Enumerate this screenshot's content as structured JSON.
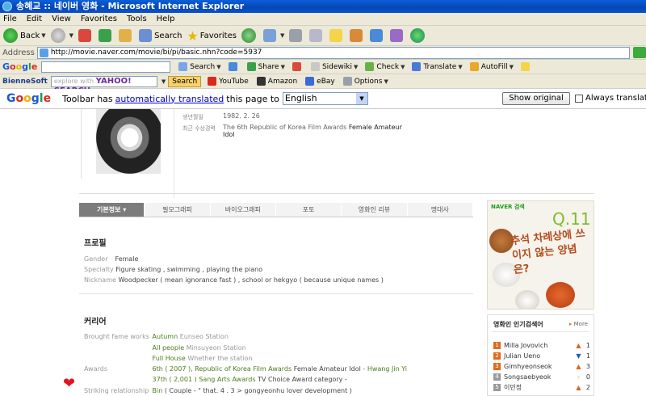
{
  "window": {
    "title": "송혜교 :: 네이버 영화 - Microsoft Internet Explorer"
  },
  "menu": [
    "File",
    "Edit",
    "View",
    "Favorites",
    "Tools",
    "Help"
  ],
  "toolbar": {
    "back": "Back",
    "search": "Search",
    "favorites": "Favorites"
  },
  "address": {
    "label": "Address",
    "url": "http://movie.naver.com/movie/bi/pi/basic.nhn?code=5937"
  },
  "google_toolbar": {
    "logo": "Google",
    "items": [
      "Search",
      "Share",
      "Sidewiki",
      "Check",
      "Translate",
      "AutoFill"
    ]
  },
  "bienne_toolbar": {
    "brand": "BienneSoft",
    "search_placeholder": "explore with",
    "search_brand": "YAHOO! SEARCH",
    "search_button": "Search",
    "items": [
      "YouTube",
      "Amazon",
      "eBay",
      "Options"
    ]
  },
  "translate_bar": {
    "logo": "Google",
    "text_before": "Toolbar has",
    "link": "automatically translated",
    "text_after": "this page to",
    "language": "English",
    "show_original": "Show original",
    "always_translate": "Always translate Ko"
  },
  "profile_info": {
    "birth_label": "생년월일",
    "birth_value": "1982. 2. 26",
    "award_label": "최근 수상경력",
    "award_prefix": "The 6th Republic of Korea Film Awards",
    "award_bold": "Female Amateur Idol"
  },
  "tabs": [
    "기본정보",
    "필모그래피",
    "바이오그래피",
    "포토",
    "영화인 리뷰",
    "명대사"
  ],
  "profile": {
    "heading": "프로필",
    "gender_label": "Gender",
    "gender_value": "Female",
    "specialty_label": "Specialty",
    "specialty_value": "Figure skating , swimming , playing the piano",
    "nickname_label": "Nickname",
    "nickname_value": "Woodpecker ( mean ignorance fast ) , school or hekgyo ( because unique names )"
  },
  "career": {
    "heading": "커리어",
    "brought_fame_label": "Brought fame works",
    "works": [
      {
        "title": "Autumn",
        "role": "Eunseo Station"
      },
      {
        "title": "All people",
        "role": "Minsuyeon Station"
      },
      {
        "title": "Full House",
        "role": "Whether the station"
      }
    ],
    "awards_label": "Awards",
    "award1_green": "6th ( 2007 ), Republic of Korea Film Awards",
    "award1_mid": "Female Amateur Idol",
    "award1_tail": "- Hwang Jin Yi",
    "award2_green": "37th ( 2,001 ) Sang Arts Awards",
    "award2_mid": "TV Choice Award category -",
    "relationship_label": "Striking relationship",
    "relationship_green": "Bin",
    "relationship_rest": "( Couple - \" that. 4 . 3 > gongyeonhu lover development )"
  },
  "ad": {
    "brand": "NAVER 검색",
    "q": "Q.11",
    "slogan": "추석 차례상에 쓰이지 않는 양념은?"
  },
  "ranking": {
    "title": "영화인 인기검색어",
    "more": "More",
    "items": [
      {
        "rank": "1",
        "name": "Milla Jovovich",
        "dir": "▲",
        "change": "1"
      },
      {
        "rank": "2",
        "name": "Julian Ueno",
        "dir": "▼",
        "change": "1"
      },
      {
        "rank": "3",
        "name": "Gimhyeonseok",
        "dir": "▲",
        "change": "3"
      },
      {
        "rank": "4",
        "name": "Songsaebyeok",
        "dir": "-",
        "change": "0"
      },
      {
        "rank": "5",
        "name": "이민정",
        "dir": "▲",
        "change": "2"
      }
    ]
  },
  "colors": {
    "title_bar": "#0646b6",
    "career_green": "#4c7c1e",
    "accent_orange": "#e06a1a"
  }
}
